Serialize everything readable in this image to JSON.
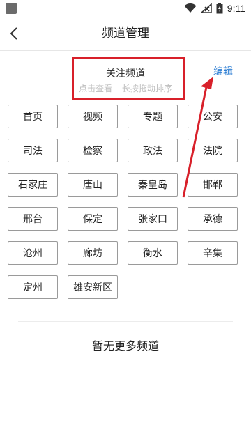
{
  "status_bar": {
    "time": "9:11"
  },
  "header": {
    "title": "频道管理",
    "back_icon": "chevron-left-icon"
  },
  "followed_section": {
    "title": "关注频道",
    "hint": "点击查看 长按拖动排序",
    "edit_label": "编辑"
  },
  "channels": [
    "首页",
    "视频",
    "专题",
    "公安",
    "司法",
    "检察",
    "政法",
    "法院",
    "石家庄",
    "唐山",
    "秦皇岛",
    "邯郸",
    "邢台",
    "保定",
    "张家口",
    "承德",
    "沧州",
    "廊坊",
    "衡水",
    "辛集",
    "定州",
    "雄安新区"
  ],
  "empty_text": "暂无更多频道",
  "colors": {
    "annotation": "#d8202a",
    "link": "#2f7fd4"
  }
}
